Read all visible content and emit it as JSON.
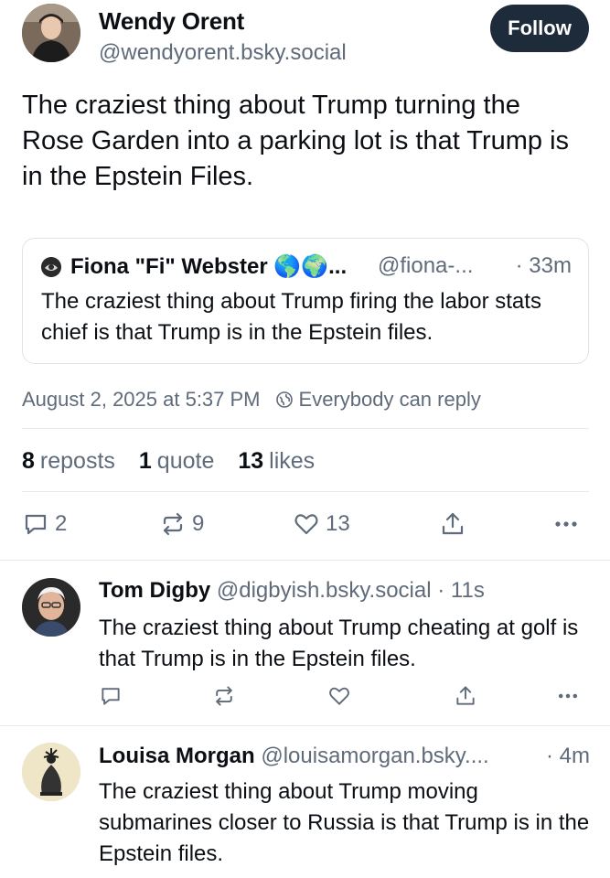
{
  "post": {
    "author_name": "Wendy Orent",
    "author_handle": "@wendyorent.bsky.social",
    "follow_label": "Follow",
    "text": "The craziest thing about Trump turning the Rose Garden into a parking lot is that Trump is in the Epstein Files.",
    "quote": {
      "author_name": "Fiona \"Fi\" Webster 🌎🌍...",
      "author_handle": "@fiona-...",
      "time": "· 33m",
      "text": "The craziest thing about Trump firing the labor stats chief is that Trump is in the Epstein files."
    },
    "timestamp": "August 2, 2025 at 5:37 PM",
    "reply_setting": "Everybody can reply",
    "stats": {
      "reposts_count": "8",
      "reposts_label": "reposts",
      "quotes_count": "1",
      "quotes_label": "quote",
      "likes_count": "13",
      "likes_label": "likes"
    },
    "actions": {
      "reply_count": "2",
      "repost_count": "9",
      "like_count": "13"
    }
  },
  "replies": [
    {
      "author_name": "Tom Digby",
      "author_handle": "@digbyish.bsky.social",
      "time": "· 11s",
      "text": "The craziest thing about Trump cheating at golf is that Trump is in the Epstein files."
    },
    {
      "author_name": "Louisa Morgan",
      "author_handle": "@louisamorgan.bsky....",
      "time": "· 4m",
      "text": "The craziest thing about Trump moving submarines closer to Russia is that Trump is in the Epstein files."
    }
  ],
  "icons": {
    "reply": "reply-icon",
    "repost": "repost-icon",
    "like": "heart-icon",
    "share": "share-icon",
    "more": "more-icon",
    "reply_setting": "globe-icon"
  },
  "colors": {
    "follow_bg": "#1e2b3b",
    "muted": "#5f6b7a",
    "text": "#0b0f14",
    "border": "#dfe4ea"
  }
}
